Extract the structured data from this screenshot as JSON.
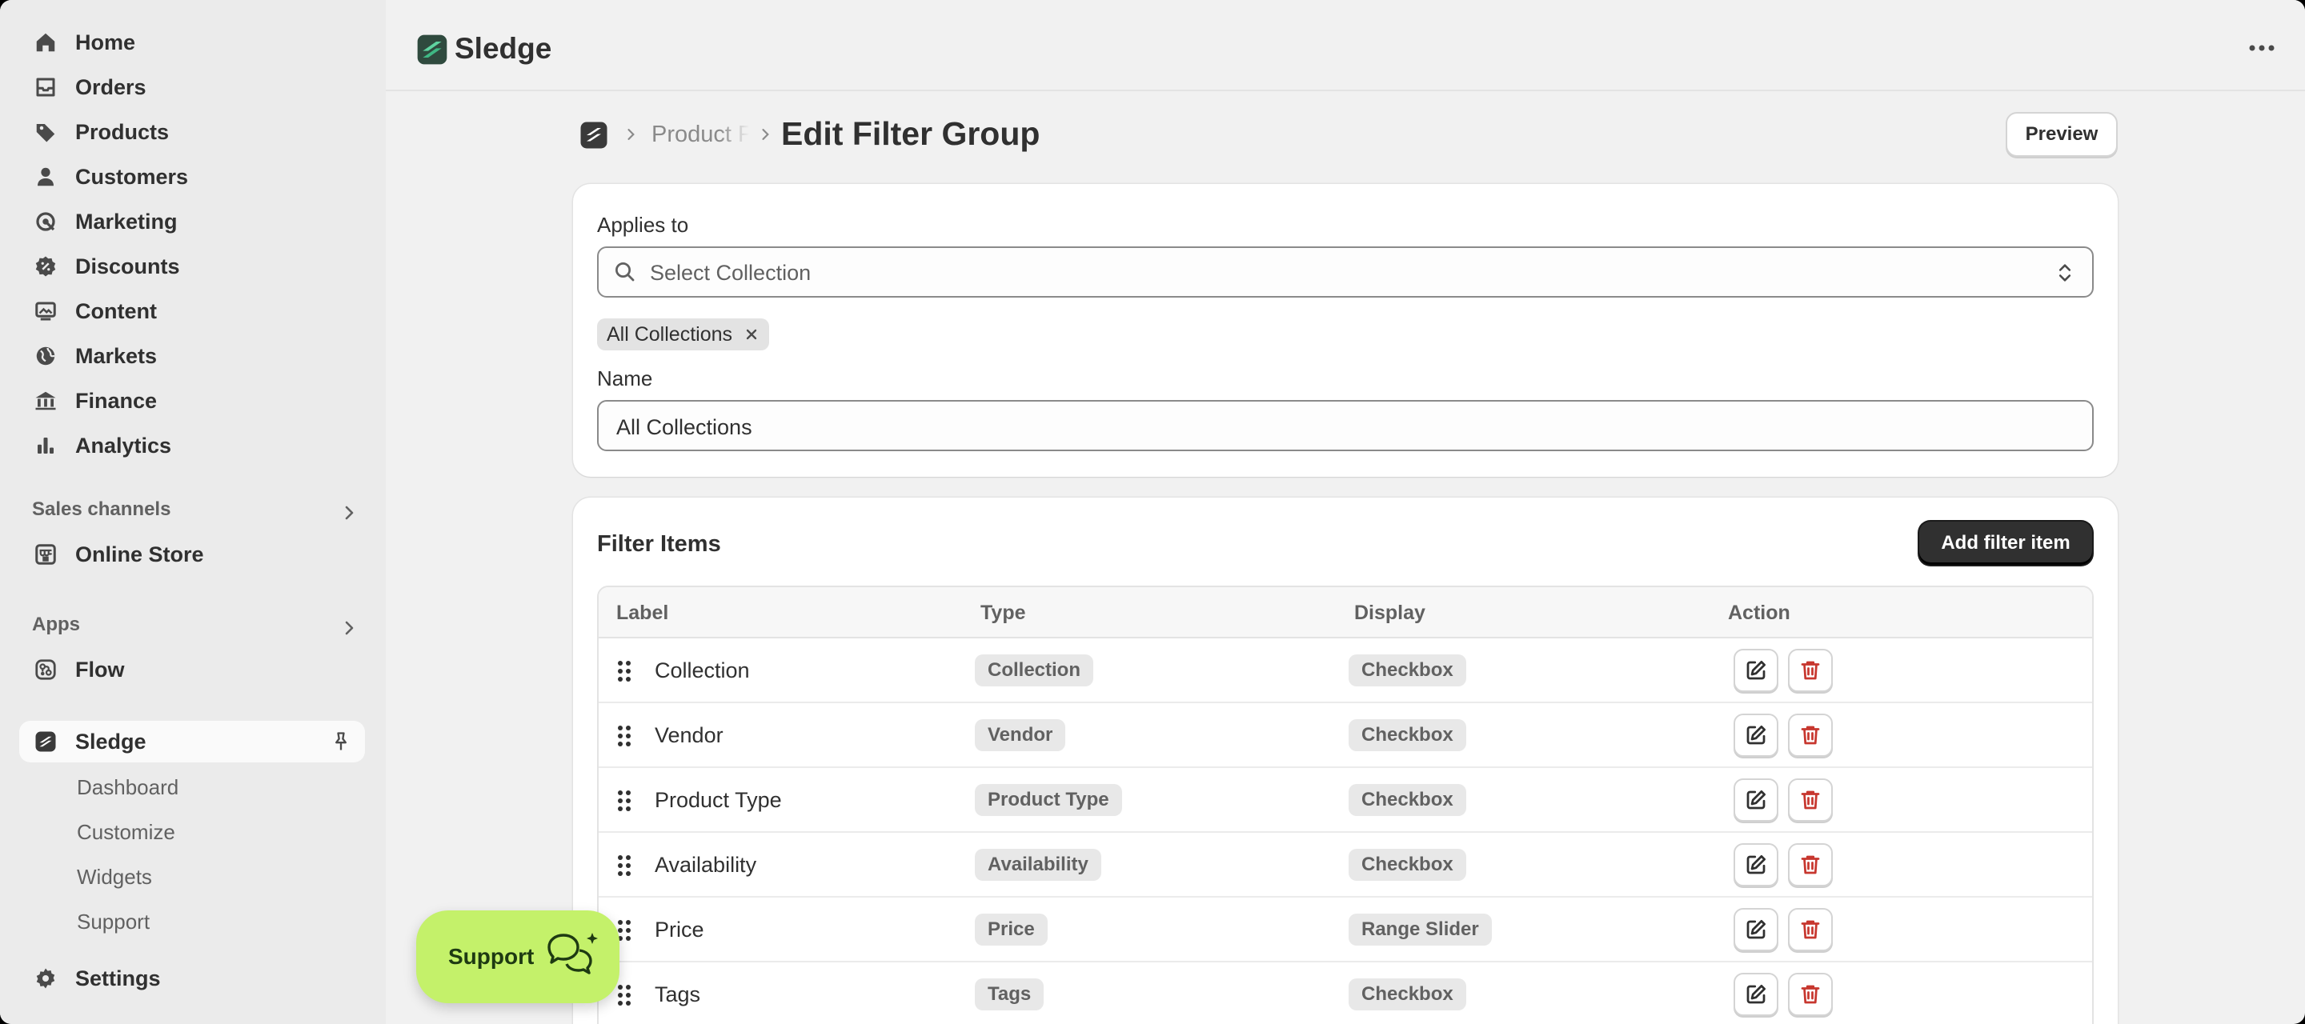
{
  "colors": {
    "accent": "#303030",
    "delete": "#c7372f",
    "support_bg": "#c4f16a",
    "brand_green": "#2e9e6f"
  },
  "sidebar": {
    "items": [
      {
        "label": "Home",
        "icon": "home-icon"
      },
      {
        "label": "Orders",
        "icon": "inbox-icon"
      },
      {
        "label": "Products",
        "icon": "tag-icon"
      },
      {
        "label": "Customers",
        "icon": "person-icon"
      },
      {
        "label": "Marketing",
        "icon": "target-icon"
      },
      {
        "label": "Discounts",
        "icon": "discount-icon"
      },
      {
        "label": "Content",
        "icon": "image-icon"
      },
      {
        "label": "Markets",
        "icon": "globe-icon"
      },
      {
        "label": "Finance",
        "icon": "bank-icon"
      },
      {
        "label": "Analytics",
        "icon": "bar-chart-icon"
      }
    ],
    "sales_channels_label": "Sales channels",
    "online_store": "Online Store",
    "apps_label": "Apps",
    "flow": "Flow",
    "sledge": "Sledge",
    "sledge_sub": [
      "Dashboard",
      "Customize",
      "Widgets",
      "Support"
    ],
    "settings": "Settings"
  },
  "topbar": {
    "app_title": "Sledge"
  },
  "header": {
    "breadcrumb": "Product Filters",
    "title": "Edit Filter Group",
    "preview_label": "Preview"
  },
  "applies": {
    "label": "Applies to",
    "placeholder": "Select Collection",
    "tag": "All Collections",
    "name_label": "Name",
    "name_value": "All Collections"
  },
  "filters": {
    "title": "Filter Items",
    "add_label": "Add filter item",
    "columns": [
      "Label",
      "Type",
      "Display",
      "Action"
    ],
    "rows": [
      {
        "label": "Collection",
        "type": "Collection",
        "display": "Checkbox"
      },
      {
        "label": "Vendor",
        "type": "Vendor",
        "display": "Checkbox"
      },
      {
        "label": "Product Type",
        "type": "Product Type",
        "display": "Checkbox"
      },
      {
        "label": "Availability",
        "type": "Availability",
        "display": "Checkbox"
      },
      {
        "label": "Price",
        "type": "Price",
        "display": "Range Slider"
      },
      {
        "label": "Tags",
        "type": "Tags",
        "display": "Checkbox"
      }
    ]
  },
  "support": {
    "label": "Support"
  }
}
